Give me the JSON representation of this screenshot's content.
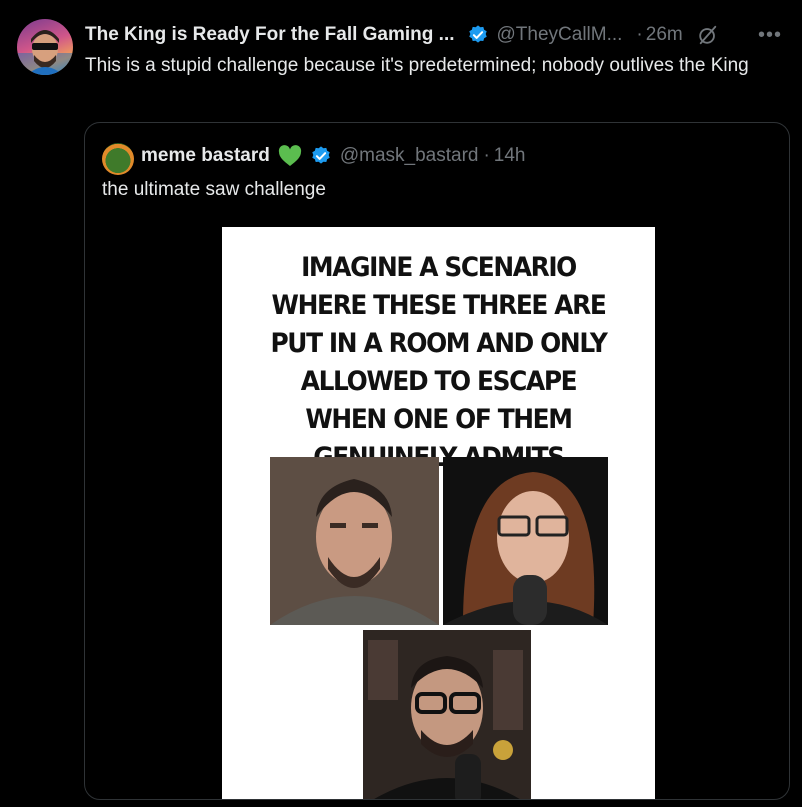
{
  "tweet": {
    "author_name": "The King is Ready For the Fall Gaming ...",
    "author_handle": "@TheyCallM...",
    "separator": "·",
    "time": "26m",
    "more_icon": "more-horizontal-icon",
    "text": "This is a stupid challenge because it's predetermined; nobody outlives the King"
  },
  "quote": {
    "author_name": "meme bastard",
    "author_handle": "@mask_bastard",
    "separator": "·",
    "time": "14h",
    "text": "the ultimate saw challenge",
    "meme_caption": "IMAGINE A SCENARIO WHERE THESE THREE ARE PUT IN A ROOM AND ONLY ALLOWED TO ESCAPE WHEN ONE OF THEM GENUINELY ADMITS THEY’RE WRONG"
  },
  "colors": {
    "background": "#000000",
    "text_primary": "#e7e9ea",
    "text_secondary": "#71767b",
    "verified": "#1d9bf0",
    "border": "#2f3336",
    "heart": "#5bbd4f"
  }
}
